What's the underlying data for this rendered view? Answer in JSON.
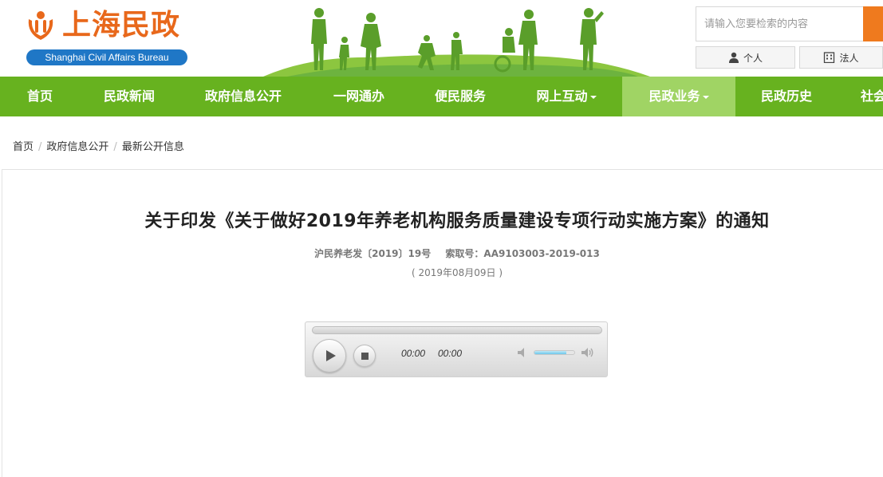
{
  "header": {
    "logo_cn": "上海民政",
    "logo_en": "Shanghai Civil Affairs Bureau",
    "search": {
      "placeholder": "请输入您要检索的内容"
    },
    "user_buttons": {
      "personal": "个人",
      "legal": "法人"
    }
  },
  "nav": {
    "items": [
      {
        "label": "首页"
      },
      {
        "label": "民政新闻"
      },
      {
        "label": "政府信息公开"
      },
      {
        "label": "一网通办"
      },
      {
        "label": "便民服务"
      },
      {
        "label": "网上互动"
      },
      {
        "label": "民政业务"
      },
      {
        "label": "民政历史"
      },
      {
        "label": "社会"
      }
    ],
    "active_index": 6
  },
  "breadcrumb": {
    "items": [
      "首页",
      "政府信息公开",
      "最新公开信息"
    ],
    "separator": "/"
  },
  "article": {
    "title": "关于印发《关于做好2019年养老机构服务质量建设专项行动实施方案》的通知",
    "doc_number": "沪民养老发〔2019〕19号",
    "index_number": "索取号：AA9103003-2019-013",
    "date": "( 2019年08月09日 )"
  },
  "audio_player": {
    "current_time": "00:00",
    "duration": "00:00",
    "volume_percent": 80
  },
  "colors": {
    "nav_bg": "#67b21f",
    "nav_active": "#a0d464",
    "logo_orange": "#e8681b",
    "logo_blue": "#1f77c6",
    "search_button": "#ef7a1e"
  }
}
